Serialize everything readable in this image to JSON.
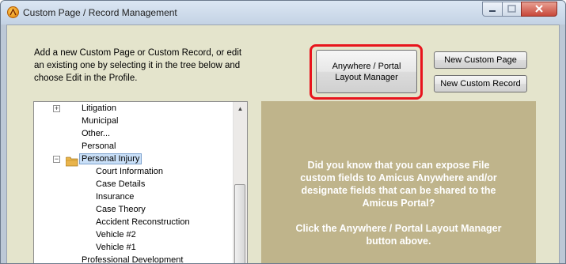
{
  "window": {
    "title": "Custom Page / Record Management"
  },
  "intro": {
    "text": "Add a new Custom Page or Custom Record, or edit an existing one by selecting it in the tree below and choose Edit in the Profile."
  },
  "buttons": {
    "portal_line1": "Anywhere / Portal",
    "portal_line2": "Layout Manager",
    "new_custom_page": "New Custom Page",
    "new_custom_record": "New Custom Record"
  },
  "tree": {
    "items": [
      {
        "label": "Litigation",
        "level": 0,
        "expander": "+"
      },
      {
        "label": "Municipal",
        "level": 0
      },
      {
        "label": "Other...",
        "level": 0
      },
      {
        "label": "Personal",
        "level": 0
      },
      {
        "label": "Personal Injury",
        "level": 0,
        "expander": "-",
        "selected": true,
        "icon": "folder-icon"
      },
      {
        "label": "Court Information",
        "level": 1
      },
      {
        "label": "Case Details",
        "level": 1
      },
      {
        "label": "Insurance",
        "level": 1
      },
      {
        "label": "Case Theory",
        "level": 1
      },
      {
        "label": "Accident Reconstruction",
        "level": 1
      },
      {
        "label": "Vehicle #2",
        "level": 1
      },
      {
        "label": "Vehicle #1",
        "level": 1
      },
      {
        "label": "Professional Development",
        "level": 0
      }
    ]
  },
  "info_panel": {
    "line1": "Did you know that you can expose File",
    "line2": "custom fields to Amicus Anywhere and/or",
    "line3": "designate fields that can be shared to the",
    "line4": "Amicus Portal?",
    "line5": "Click the Anywhere / Portal Layout Manager",
    "line6": "button above."
  },
  "colors": {
    "client_bg": "#e4e4cc",
    "info_panel_bg": "#bfb48b",
    "highlight": "#e8141c",
    "selection": "#c9dff7"
  }
}
